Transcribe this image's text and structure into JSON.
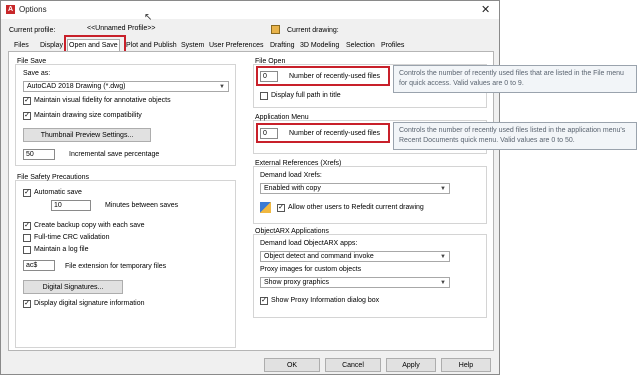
{
  "window": {
    "title": "Options"
  },
  "header": {
    "current_profile_label": "Current profile:",
    "current_profile_value": "<<Unnamed Profile>>",
    "current_drawing_label": "Current drawing:"
  },
  "tabs": [
    {
      "label": "Files"
    },
    {
      "label": "Display"
    },
    {
      "label": "Open and Save"
    },
    {
      "label": "Plot and Publish"
    },
    {
      "label": "System"
    },
    {
      "label": "User Preferences"
    },
    {
      "label": "Drafting"
    },
    {
      "label": "3D Modeling"
    },
    {
      "label": "Selection"
    },
    {
      "label": "Profiles"
    }
  ],
  "file_save": {
    "title": "File Save",
    "save_as_label": "Save as:",
    "save_as_value": "AutoCAD 2018 Drawing (*.dwg)",
    "maintain_fidelity": {
      "label": "Maintain visual fidelity for annotative objects",
      "checked": "✓"
    },
    "maintain_size": {
      "label": "Maintain drawing size compatibility",
      "checked": "✓"
    },
    "thumbnail_button": "Thumbnail Preview Settings...",
    "incremental_value": "50",
    "incremental_label": "Incremental save percentage"
  },
  "file_safety": {
    "title": "File Safety Precautions",
    "automatic_save": {
      "label": "Automatic save",
      "checked": "✓"
    },
    "minutes_value": "10",
    "minutes_label": "Minutes between saves",
    "backup_copy": {
      "label": "Create backup copy with each save",
      "checked": "✓"
    },
    "crc_validation": {
      "label": "Full-time CRC validation",
      "checked": ""
    },
    "log_file": {
      "label": "Maintain a log file",
      "checked": ""
    },
    "temp_ext_value": "ac$",
    "temp_ext_label": "File extension for temporary files",
    "digital_signatures_button": "Digital Signatures...",
    "display_signature": {
      "label": "Display digital signature information",
      "checked": "✓"
    }
  },
  "file_open": {
    "title": "File Open",
    "recent_files_value": "0",
    "recent_files_label": "Number of recently-used files",
    "full_path": {
      "label": "Display full path in title",
      "checked": ""
    },
    "tooltip": "Controls the number of recently used files that are listed in the File menu for quick access. Valid values are 0 to 9."
  },
  "application_menu": {
    "title": "Application Menu",
    "recent_files_value": "0",
    "recent_files_label": "Number of recently-used files",
    "tooltip": "Controls the number of recently used files listed in the application menu's Recent Documents quick menu. Valid values are 0 to 50."
  },
  "xrefs": {
    "title": "External References (Xrefs)",
    "demand_load_label": "Demand load Xrefs:",
    "demand_load_value": "Enabled with copy",
    "allow_edit": {
      "label": "Allow other users to Refedit current drawing",
      "checked": "✓"
    }
  },
  "objectarx": {
    "title": "ObjectARX Applications",
    "demand_load_label": "Demand load ObjectARX apps:",
    "demand_load_value": "Object detect and command invoke",
    "proxy_label": "Proxy images for custom objects",
    "proxy_value": "Show proxy graphics",
    "show_proxy_dialog": {
      "label": "Show Proxy Information dialog box",
      "checked": "✓"
    }
  },
  "footer": {
    "ok": "OK",
    "cancel": "Cancel",
    "apply": "Apply",
    "help": "Help"
  }
}
